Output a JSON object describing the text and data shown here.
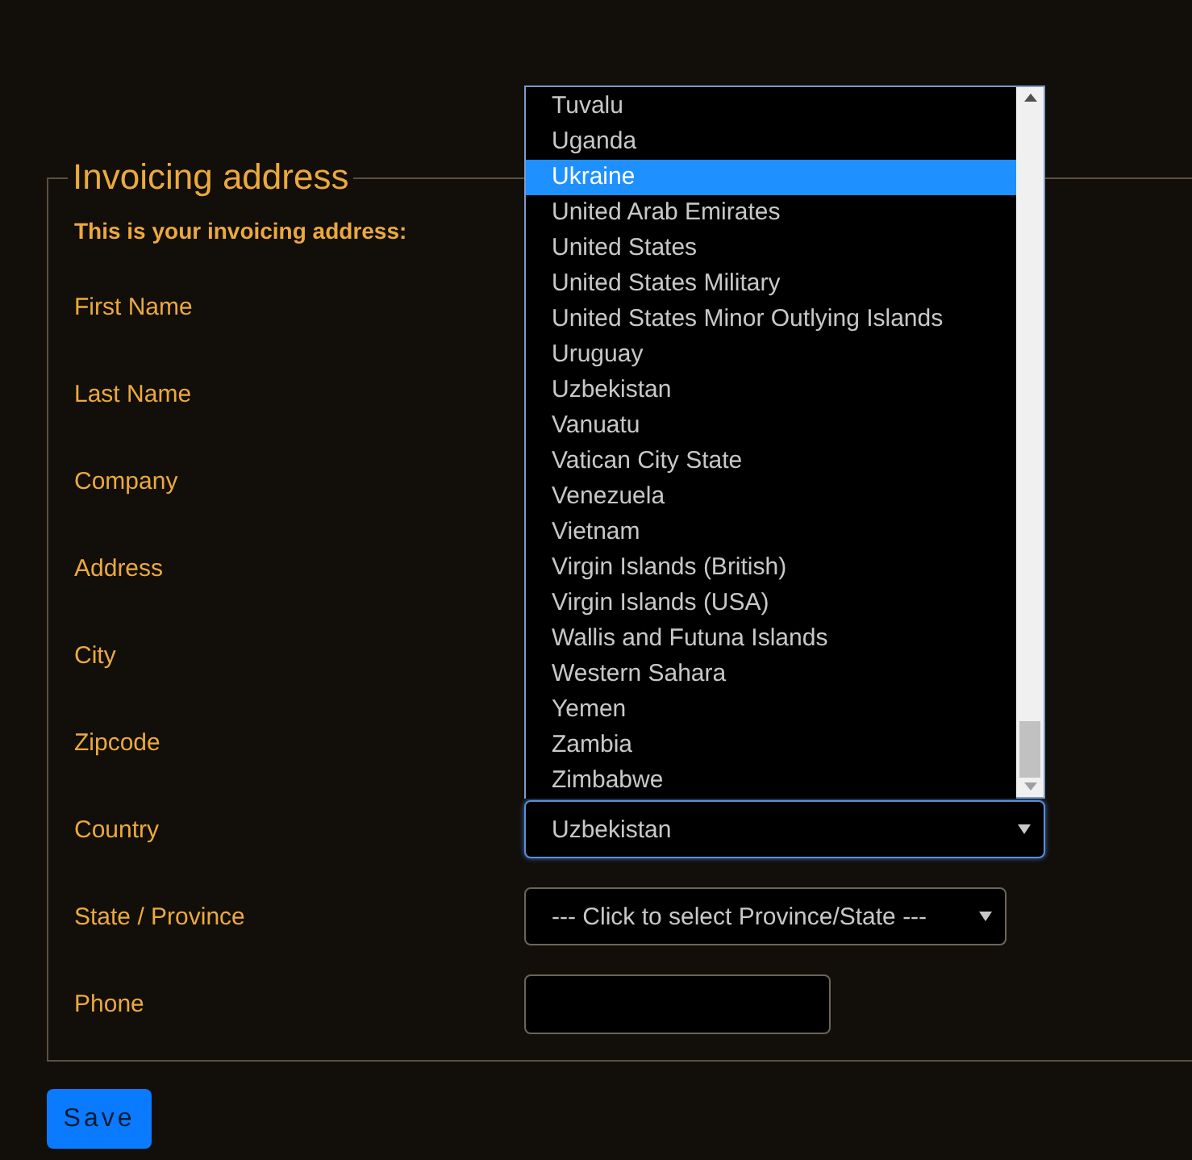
{
  "invoicing_address": {
    "legend": "Invoicing address",
    "subtitle": "This is your invoicing address:",
    "fields": [
      {
        "label": "First Name",
        "kind": "covered"
      },
      {
        "label": "Last Name",
        "kind": "covered"
      },
      {
        "label": "Company",
        "kind": "covered"
      },
      {
        "label": "Address",
        "kind": "covered"
      },
      {
        "label": "City",
        "kind": "covered"
      },
      {
        "label": "Zipcode",
        "kind": "covered"
      },
      {
        "label": "Country",
        "kind": "select",
        "value": "Uzbekistan",
        "focused": true
      },
      {
        "label": "State / Province",
        "kind": "select",
        "value": "--- Click to select Province/State ---",
        "focused": false
      },
      {
        "label": "Phone",
        "kind": "input"
      }
    ]
  },
  "country_dropdown": {
    "options": [
      {
        "label": "Tuvalu",
        "selected": false
      },
      {
        "label": "Uganda",
        "selected": false
      },
      {
        "label": "Ukraine",
        "selected": true
      },
      {
        "label": "United Arab Emirates",
        "selected": false
      },
      {
        "label": "United States",
        "selected": false
      },
      {
        "label": "United States Military",
        "selected": false
      },
      {
        "label": "United States Minor Outlying Islands",
        "selected": false
      },
      {
        "label": "Uruguay",
        "selected": false
      },
      {
        "label": "Uzbekistan",
        "selected": false
      },
      {
        "label": "Vanuatu",
        "selected": false
      },
      {
        "label": "Vatican City State",
        "selected": false
      },
      {
        "label": "Venezuela",
        "selected": false
      },
      {
        "label": "Vietnam",
        "selected": false
      },
      {
        "label": "Virgin Islands (British)",
        "selected": false
      },
      {
        "label": "Virgin Islands (USA)",
        "selected": false
      },
      {
        "label": "Wallis and Futuna Islands",
        "selected": false
      },
      {
        "label": "Western Sahara",
        "selected": false
      },
      {
        "label": "Yemen",
        "selected": false
      },
      {
        "label": "Zambia",
        "selected": false
      },
      {
        "label": "Zimbabwe",
        "selected": false
      }
    ]
  },
  "save_button": "Save"
}
